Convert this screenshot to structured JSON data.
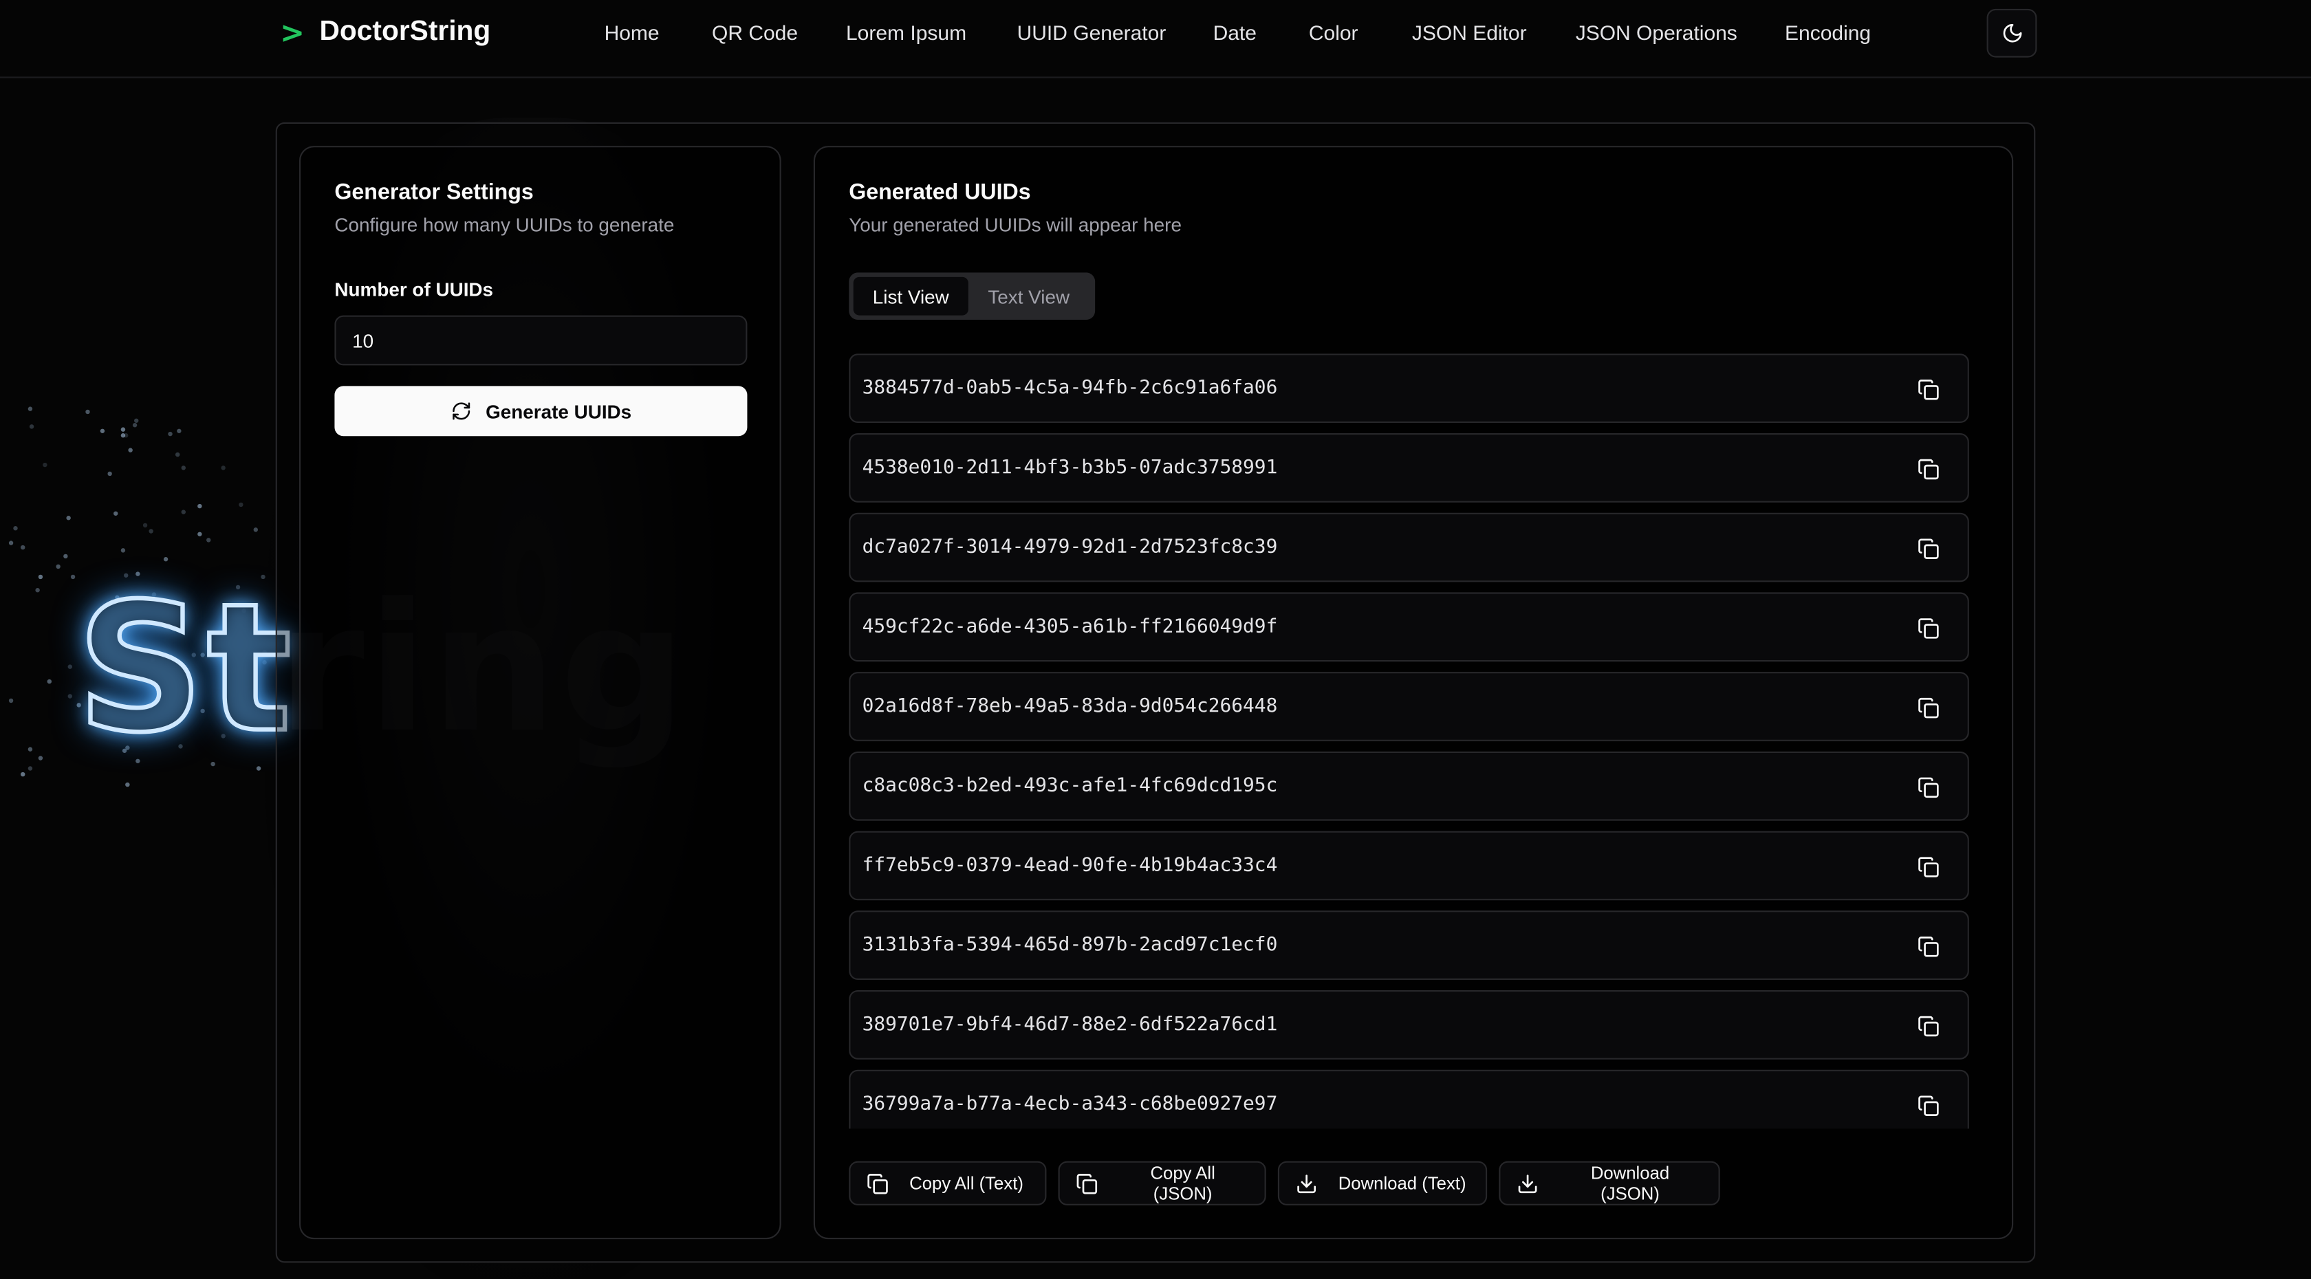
{
  "brand": {
    "chevron": ">",
    "name": "DoctorString"
  },
  "nav": {
    "links": [
      "Home",
      "QR Code",
      "Lorem Ipsum",
      "UUID Generator",
      "Date",
      "Color",
      "JSON Editor",
      "JSON Operations",
      "Encoding"
    ],
    "theme_icon": "moon-icon"
  },
  "background": {
    "art_text": "St",
    "faded_text": "ring"
  },
  "settings": {
    "title": "Generator Settings",
    "description": "Configure how many UUIDs to generate",
    "count_label": "Number of UUIDs",
    "count_value": "10",
    "generate_label": "Generate UUIDs",
    "generate_icon": "refresh-icon"
  },
  "results": {
    "title": "Generated UUIDs",
    "description": "Your generated UUIDs will appear here",
    "tabs": [
      {
        "label": "List View",
        "active": true
      },
      {
        "label": "Text View",
        "active": false
      }
    ],
    "uuids": [
      "3884577d-0ab5-4c5a-94fb-2c6c91a6fa06",
      "4538e010-2d11-4bf3-b3b5-07adc3758991",
      "dc7a027f-3014-4979-92d1-2d7523fc8c39",
      "459cf22c-a6de-4305-a61b-ff2166049d9f",
      "02a16d8f-78eb-49a5-83da-9d054c266448",
      "c8ac08c3-b2ed-493c-afe1-4fc69dcd195c",
      "ff7eb5c9-0379-4ead-90fe-4b19b4ac33c4",
      "3131b3fa-5394-465d-897b-2acd97c1ecf0",
      "389701e7-9bf4-46d7-88e2-6df522a76cd1",
      "36799a7a-b77a-4ecb-a343-c68be0927e97"
    ],
    "row_icon": "copy-icon",
    "actions": [
      {
        "label": "Copy All (Text)",
        "icon": "copy-icon"
      },
      {
        "label": "Copy All (JSON)",
        "icon": "copy-icon"
      },
      {
        "label": "Download (Text)",
        "icon": "download-icon"
      },
      {
        "label": "Download (JSON)",
        "icon": "download-icon"
      }
    ]
  },
  "colors": {
    "accent": "#22c55e",
    "background": "#050505",
    "border": "#27272a",
    "muted_text": "#a1a1aa"
  }
}
